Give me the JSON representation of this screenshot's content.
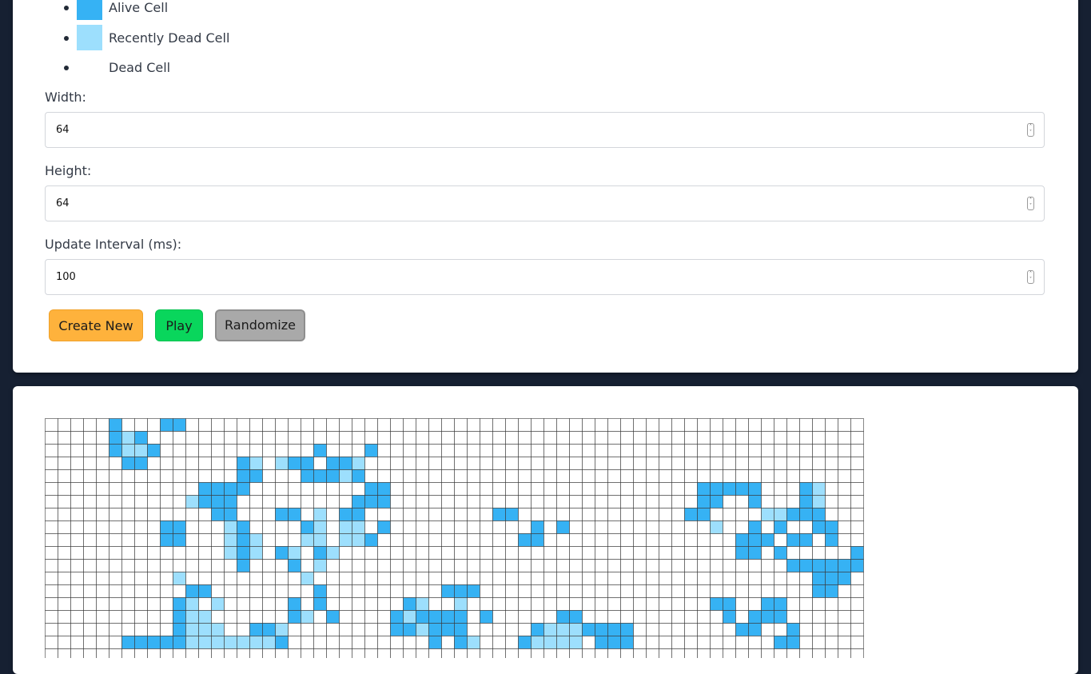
{
  "legend": {
    "items": [
      {
        "label": "Alive Cell",
        "color": "#36b2f4"
      },
      {
        "label": "Recently Dead Cell",
        "color": "#9ddffd"
      },
      {
        "label": "Dead Cell",
        "color": "#ffffff"
      }
    ]
  },
  "controls": {
    "width_label": "Width:",
    "width_value": "64",
    "height_label": "Height:",
    "height_value": "64",
    "interval_label": "Update Interval (ms):",
    "interval_value": "100",
    "create_button": "Create New",
    "play_button": "Play",
    "randomize_button": "Randomize",
    "spinner_icon": "stepper-arrows-icon"
  },
  "board": {
    "columns": 64,
    "rows": 64,
    "visible_rows": 19,
    "colors": {
      "alive": "#36b2f4",
      "recent": "#9ddffd",
      "dead": "#ffffff",
      "gridline": "#3a3a3a"
    },
    "rows_data": [
      "00000A000AA00000000000000000000000000000000000000000000000000000",
      "00000ARA00000000000000000000000000000000000000000000000000000000",
      "00000ARRA000000000000A000A000000000000000000000000000000000000000",
      "000000AA0000000AR0RAA0AAR000000000000000000000000000000000000000",
      "000000000000000AA000AAARA000000000000000000000000000000000000000",
      "000000000000AAAA000000000AA000000000000000000000000AAAAA000AR000",
      "00000000000RAAA000000000AAA000000000000000000000000AA00A000AR000",
      "0000000000000AA000AA0R0AA0000000000AA0000000000000AA0000RRAAA000",
      "000000000AA000RA0000AR0RR0A00000000000A0A00000000000R00A0A00AA000",
      "000000000AA000RAR000RR0RRA00000000000AA000000000000000AAA0AA0A000",
      "00000000000000RAR0AR0AR0000000000000000000000000000000AA0A00000A000",
      "000000000000000A000A0R000000000000000000000000000000000000AAAAAA00",
      "0000000000R000000000R000000000000000000000000000000000000000AAA000",
      "00000000000AA00000000A000000000AAA00000000000000000000000000AA0000",
      "0000000000AR0R00000A0A000000AR00R0000000000000000000AA00AA0000000000",
      "0000000000ARR000000AR0A0000ARAAAA0A00000AA00000000000A0AAA000000000",
      "0000000000ARRR00AAR00000000AARAAA00000ARRRAAAA00000000AA00A000000000",
      "000000AAAAARRRRRRRA00000000000A0AR000ARRRR0AAA00000000000AA000000AR000",
      "00000000000000000000000000000000000000000000000000000000000000000"
    ]
  }
}
